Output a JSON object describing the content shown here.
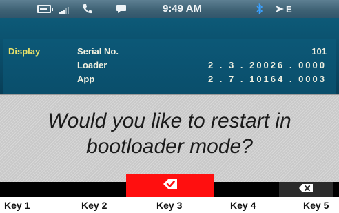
{
  "status_bar": {
    "time": "9:49 AM",
    "network_label": "E",
    "icons": [
      "battery-icon",
      "signal-icon",
      "phone-icon",
      "chat-icon",
      "bluetooth-icon",
      "network-icon"
    ]
  },
  "info": {
    "section_label": "Display",
    "rows": [
      {
        "label": "Serial No.",
        "value": "101"
      },
      {
        "label": "Loader",
        "value": "2 . 3 . 20026 . 0000"
      },
      {
        "label": "App",
        "value": "2 . 7 . 10164 . 0003"
      }
    ]
  },
  "dialog": {
    "message_line1": "Would you like to restart in",
    "message_line2": "bootloader mode?"
  },
  "softkeys": {
    "key3_icon": "checkmark-icon",
    "key5_icon": "delete-icon",
    "key3_color": "#ff0f0f"
  },
  "key_labels": [
    "Key 1",
    "Key 2",
    "Key 3",
    "Key 4",
    "Key 5"
  ]
}
